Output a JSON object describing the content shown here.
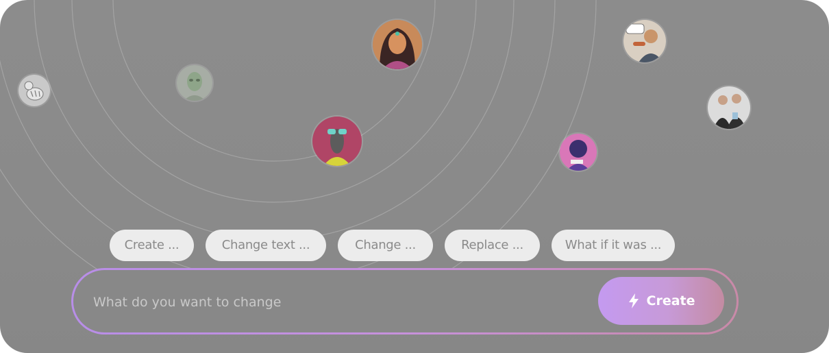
{
  "suggestions": [
    {
      "label": "Create ..."
    },
    {
      "label": "Change text ..."
    },
    {
      "label": "Change ..."
    },
    {
      "label": "Replace ..."
    },
    {
      "label": "What if it was ..."
    }
  ],
  "prompt": {
    "placeholder": "What do you want to change",
    "value": ""
  },
  "create_button": {
    "label": "Create",
    "icon": "lightning-icon"
  },
  "avatars": [
    {
      "name": "avatar-cartoon-zebra"
    },
    {
      "name": "avatar-green-alien"
    },
    {
      "name": "avatar-woman-portrait"
    },
    {
      "name": "avatar-dog-sunglasses"
    },
    {
      "name": "avatar-purple-character"
    },
    {
      "name": "avatar-man-hotdog-make-eat-again"
    },
    {
      "name": "avatar-two-men-suits"
    }
  ],
  "colors": {
    "background": "#8a8a8a",
    "chip_bg": "#ececec",
    "accent_start": "#c49af0",
    "accent_end": "#c48ba2"
  }
}
